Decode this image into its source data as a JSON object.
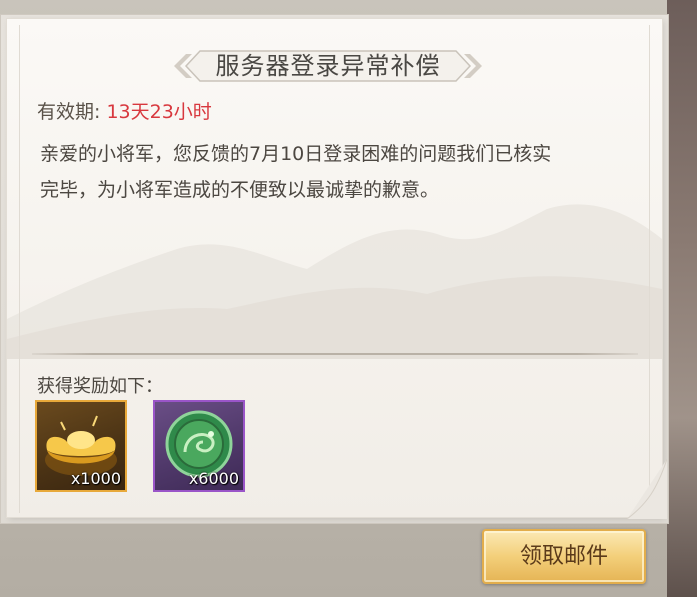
{
  "mail": {
    "title": "服务器登录异常补偿",
    "validity_label": "有效期:",
    "validity_value": "13天23小时",
    "body_line1": "亲爱的小将军，您反馈的7月10日登录困难的问题我们已核实",
    "body_line2": "完毕，为小将军造成的不便致以最诚挚的歉意。"
  },
  "rewards": {
    "title": "获得奖励如下：",
    "items": [
      {
        "icon": "gold-ingot-icon",
        "count": "x1000",
        "frame_color": "#e8a93a"
      },
      {
        "icon": "jade-dragon-coin-icon",
        "count": "x6000",
        "frame_color": "#9a55c8"
      }
    ]
  },
  "actions": {
    "claim_label": "领取邮件"
  },
  "colors": {
    "accent_red": "#d8383e",
    "button_gold": "#f3cf7a"
  }
}
